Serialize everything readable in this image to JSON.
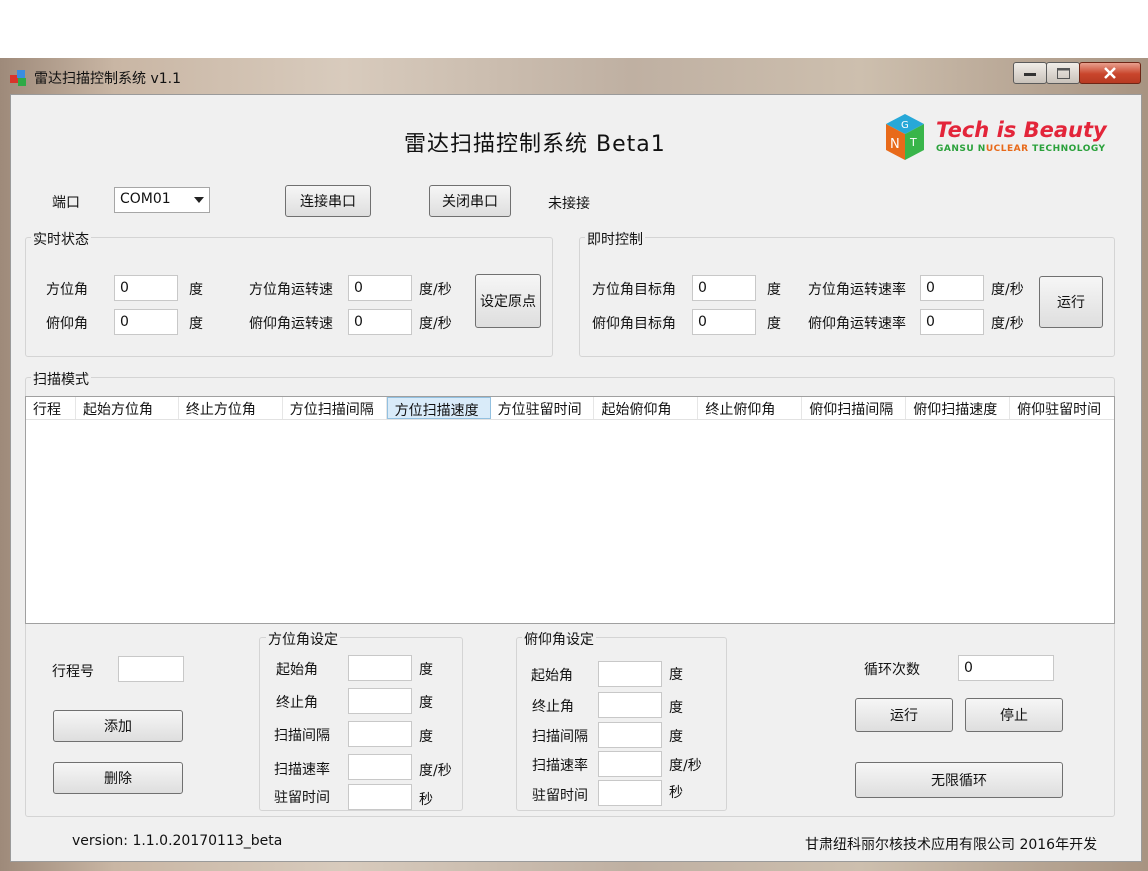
{
  "window": {
    "title": "雷达扫描控制系统 v1.1"
  },
  "app_title": "雷达扫描控制系统 Beta1",
  "logo": {
    "title": "Tech is Beauty",
    "subtitle_a": "GANSU N",
    "subtitle_b": "UCLEAR",
    "subtitle_c": " TECHNOLOGY",
    "cube_letters": [
      "N",
      "G",
      "T"
    ]
  },
  "connection": {
    "port_label": "端口",
    "port_value": "COM01",
    "connect_label": "连接串口",
    "close_label": "关闭串口",
    "status": "未接接"
  },
  "realtime": {
    "title": "实时状态",
    "azimuth_label": "方位角",
    "azimuth_value": "0",
    "azimuth_unit": "度",
    "azimuth_speed_label": "方位角运转速",
    "azimuth_speed_value": "0",
    "azimuth_speed_unit": "度/秒",
    "elevation_label": "俯仰角",
    "elevation_value": "0",
    "elevation_unit": "度",
    "elevation_speed_label": "俯仰角运转速",
    "elevation_speed_value": "0",
    "elevation_speed_unit": "度/秒",
    "set_origin_label": "设定原点"
  },
  "instant": {
    "title": "即时控制",
    "az_target_label": "方位角目标角",
    "az_target_value": "0",
    "az_target_unit": "度",
    "az_rate_label": "方位角运转速率",
    "az_rate_value": "0",
    "az_rate_unit": "度/秒",
    "el_target_label": "俯仰角目标角",
    "el_target_value": "0",
    "el_target_unit": "度",
    "el_rate_label": "俯仰角运转速率",
    "el_rate_value": "0",
    "el_rate_unit": "度/秒",
    "run_label": "运行"
  },
  "scan": {
    "title": "扫描模式",
    "columns": [
      "行程",
      "起始方位角",
      "终止方位角",
      "方位扫描间隔",
      "方位扫描速度",
      "方位驻留时间",
      "起始俯仰角",
      "终止俯仰角",
      "俯仰扫描间隔",
      "俯仰扫描速度",
      "俯仰驻留时间"
    ]
  },
  "trip": {
    "label": "行程号",
    "value": "",
    "add_label": "添加",
    "delete_label": "删除"
  },
  "az_setting": {
    "title": "方位角设定",
    "start_label": "起始角",
    "start_unit": "度",
    "end_label": "终止角",
    "end_unit": "度",
    "interval_label": "扫描间隔",
    "interval_unit": "度",
    "speed_label": "扫描速率",
    "speed_unit": "度/秒",
    "dwell_label": "驻留时间",
    "dwell_unit": "秒"
  },
  "el_setting": {
    "title": "俯仰角设定",
    "start_label": "起始角",
    "start_unit": "度",
    "end_label": "终止角",
    "end_unit": "度",
    "interval_label": "扫描间隔",
    "interval_unit": "度",
    "speed_label": "扫描速率",
    "speed_unit": "度/秒",
    "dwell_label": "驻留时间",
    "dwell_unit": "秒"
  },
  "loop": {
    "count_label": "循环次数",
    "count_value": "0",
    "run_label": "运行",
    "stop_label": "停止",
    "infinite_label": "无限循环"
  },
  "footer": {
    "version": "version: 1.1.0.20170113_beta",
    "company": "甘肃纽科丽尔核技术应用有限公司 2016年开发"
  },
  "colors": {
    "logo_red": "#e3253a",
    "logo_green": "#2aa13b",
    "logo_orange": "#e86a1a",
    "close_red": "#c9452c"
  }
}
